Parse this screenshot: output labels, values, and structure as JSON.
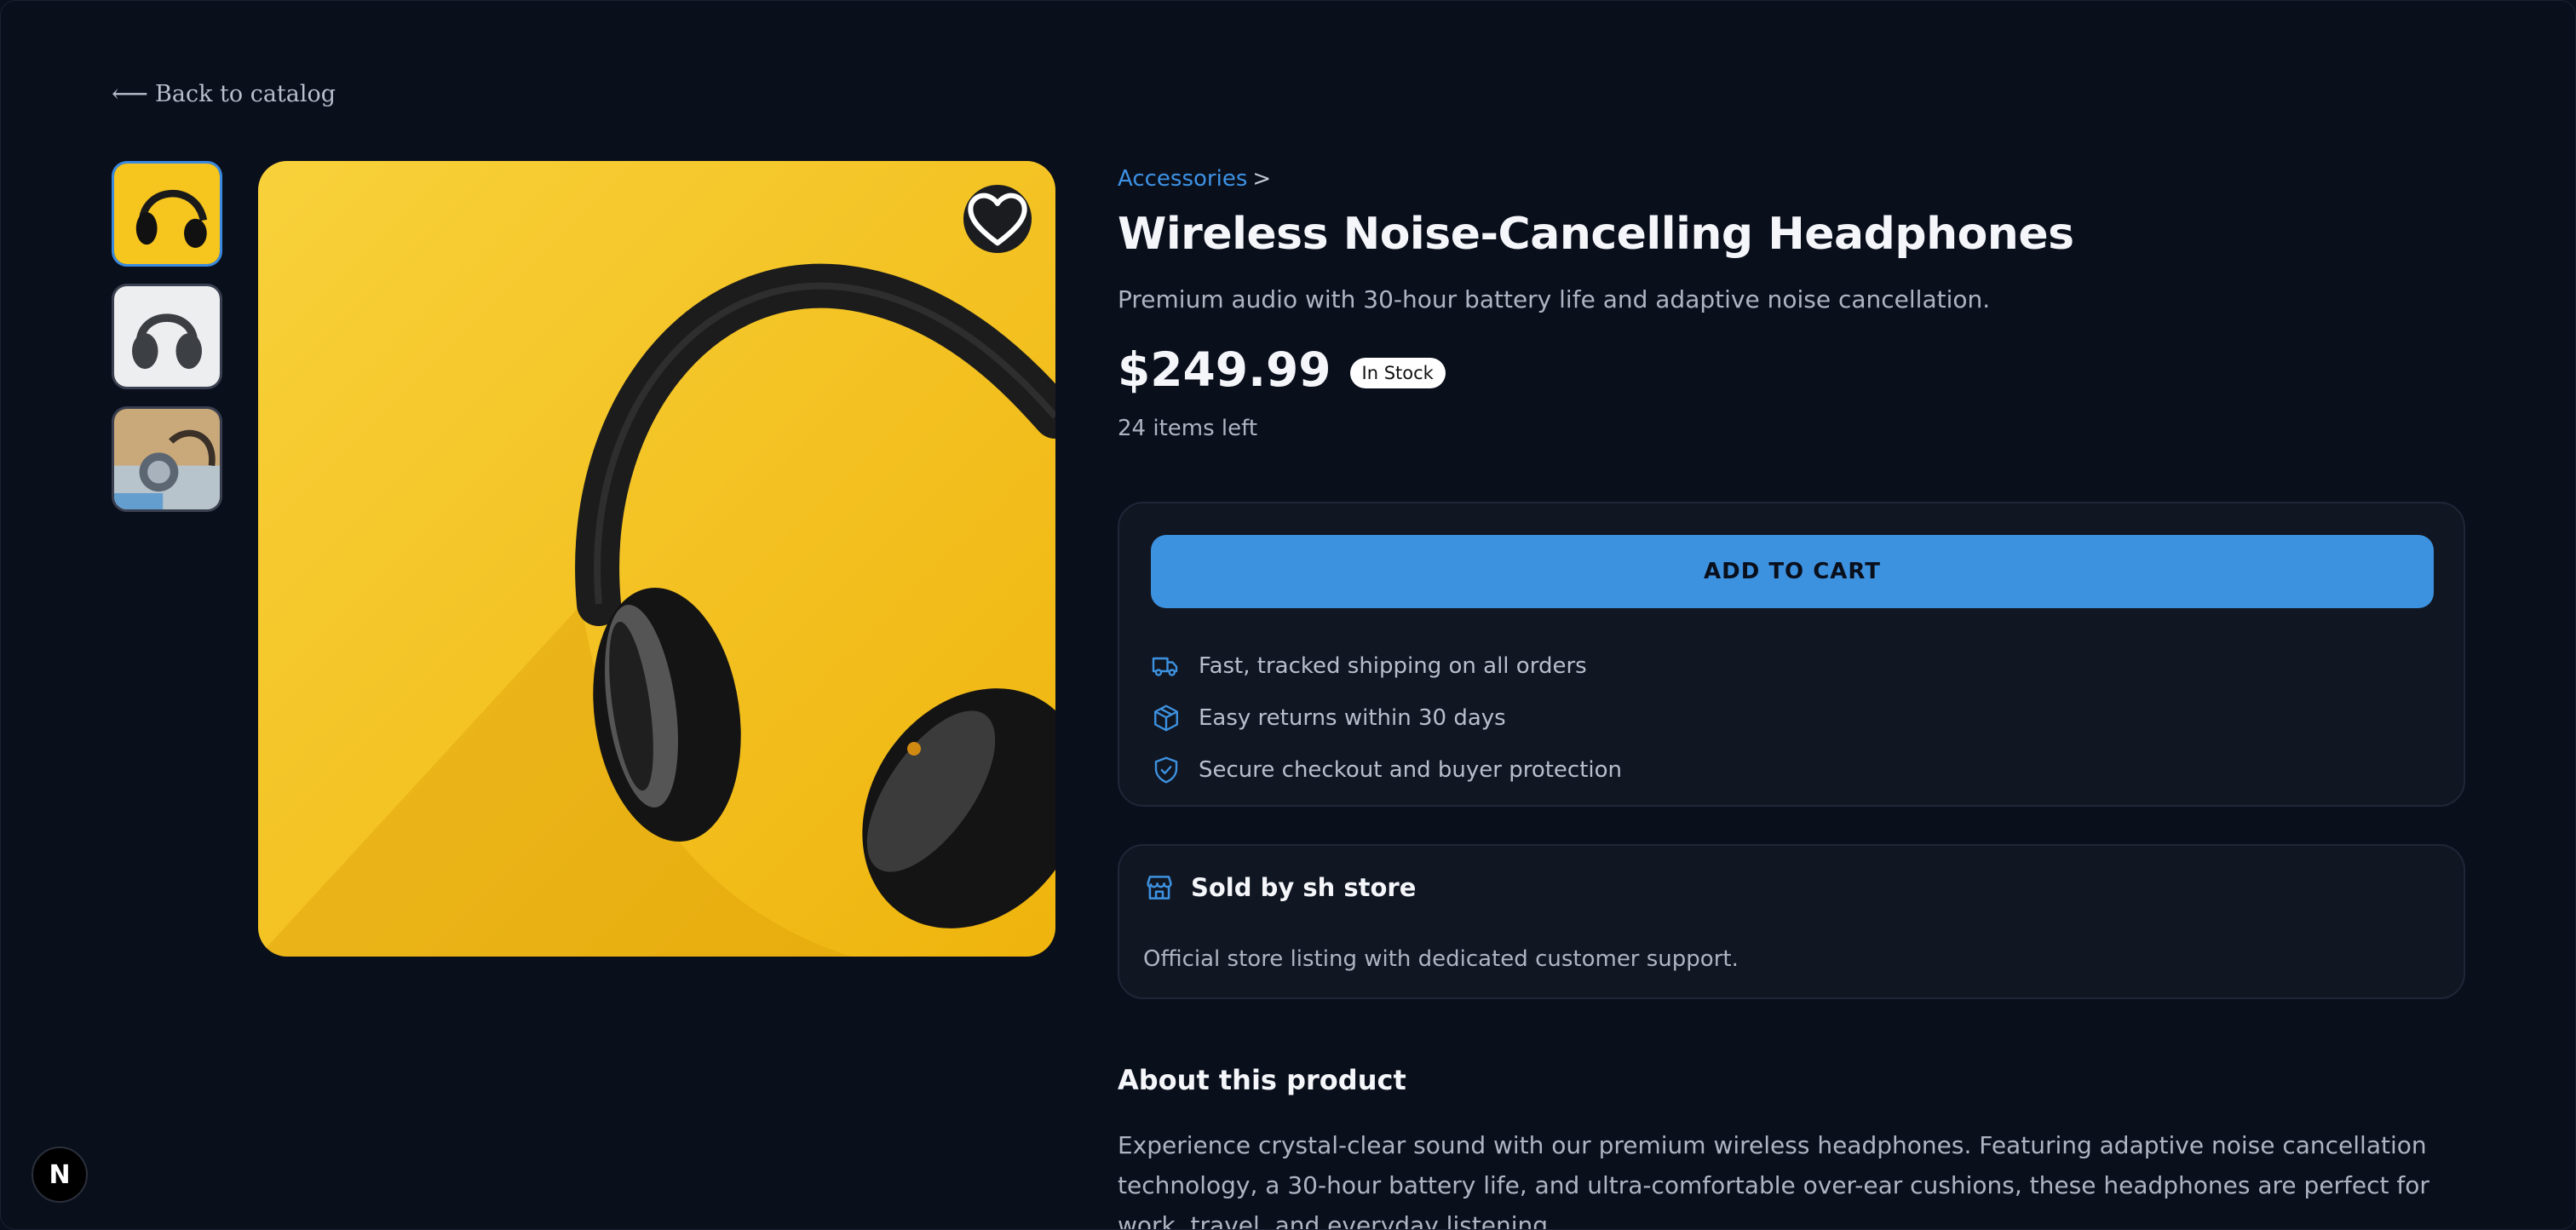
{
  "nav": {
    "back_label": "Back to catalog"
  },
  "gallery": {
    "thumbnails": [
      {
        "description": "yellow-headphones",
        "active": true
      },
      {
        "description": "gray-headphones",
        "active": false
      },
      {
        "description": "headphones-on-desk",
        "active": false
      }
    ],
    "favorite_icon": "heart-icon"
  },
  "product": {
    "category": "Accessories",
    "breadcrumb_separator": ">",
    "title": "Wireless Noise-Cancelling Headphones",
    "subtitle": "Premium audio with 30-hour battery life and adaptive noise cancellation.",
    "price": "$249.99",
    "stock_badge": "In Stock",
    "items_left": "24 items left"
  },
  "cart": {
    "add_label": "ADD TO CART",
    "features": [
      {
        "icon": "truck-icon",
        "label": "Fast, tracked shipping on all orders"
      },
      {
        "icon": "box-icon",
        "label": "Easy returns within 30 days"
      },
      {
        "icon": "shield-check-icon",
        "label": "Secure checkout and buyer protection"
      }
    ]
  },
  "seller": {
    "icon": "store-icon",
    "label": "Sold by sh store",
    "description": "Official store listing with dedicated customer support."
  },
  "about": {
    "title": "About this product",
    "text": "Experience crystal-clear sound with our premium wireless headphones. Featuring adaptive noise cancellation technology, a 30-hour battery life, and ultra-comfortable over-ear cushions, these headphones are perfect for work, travel, and everyday listening."
  },
  "dev": {
    "badge_label": "N"
  },
  "colors": {
    "background": "#0a0f1c",
    "accent": "#3d92e0",
    "card": "#111623"
  }
}
